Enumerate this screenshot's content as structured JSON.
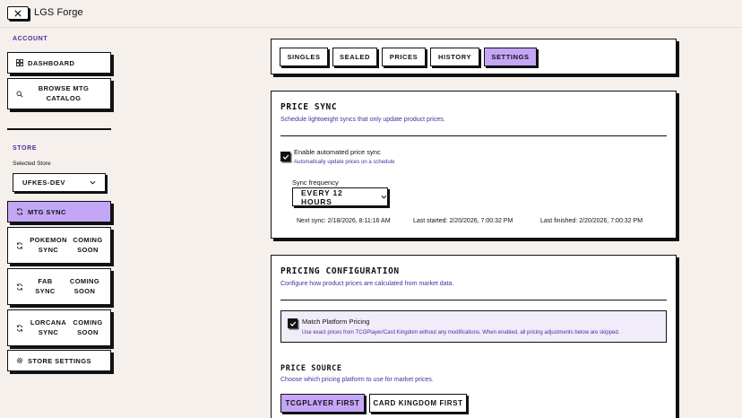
{
  "app": {
    "title": "LGS Forge"
  },
  "sidebar": {
    "account_label": "ACCOUNT",
    "store_label": "STORE",
    "selected_store_label": "Selected Store",
    "selected_store_value": "UFKES-DEV",
    "dashboard": "DASHBOARD",
    "browse": "BROWSE MTG CATALOG",
    "mtg_sync": "MTG SYNC",
    "pokemon_sync": "POKEMON SYNC",
    "pokemon_status": "COMING SOON",
    "fab_sync": "FAB SYNC",
    "fab_status": "COMING SOON",
    "lorcana_sync": "LORCANA SYNC",
    "lorcana_status": "COMING SOON",
    "store_settings": "STORE SETTINGS"
  },
  "tabs": [
    "SINGLES",
    "SEALED",
    "PRICES",
    "HISTORY",
    "SETTINGS"
  ],
  "active_tab": "SETTINGS",
  "price_sync": {
    "title": "PRICE SYNC",
    "subtitle": "Schedule lightweight syncs that only update product prices.",
    "enable_label": "Enable automated price sync",
    "enable_sub": "Automatically update prices on a schedule",
    "enabled": true,
    "freq_label": "Sync frequency",
    "freq_value": "EVERY 12 HOURS",
    "next_sync": "Next sync: 2/18/2026, 8:11:16 AM",
    "last_started": "Last started: 2/20/2026, 7:00:32 PM",
    "last_finished": "Last finished: 2/20/2026, 7:00:32 PM"
  },
  "pricing_config": {
    "title": "PRICING CONFIGURATION",
    "subtitle": "Configure how product prices are calculated from market data.",
    "match_label": "Match Platform Pricing",
    "match_sub": "Use exact prices from TCGPlayer/Card Kingdom without any modifications. When enabled, all pricing adjustments below are skipped.",
    "match_enabled": true,
    "source_title": "PRICE SOURCE",
    "source_sub": "Choose which pricing platform to use for market prices.",
    "source_options": [
      "TCGPLAYER FIRST",
      "CARD KINGDOM FIRST"
    ],
    "source_selected": "TCGPLAYER FIRST"
  },
  "colors": {
    "accent": "#c4a6f7",
    "link": "#4b2ca0",
    "background": "#f5f0ec"
  }
}
